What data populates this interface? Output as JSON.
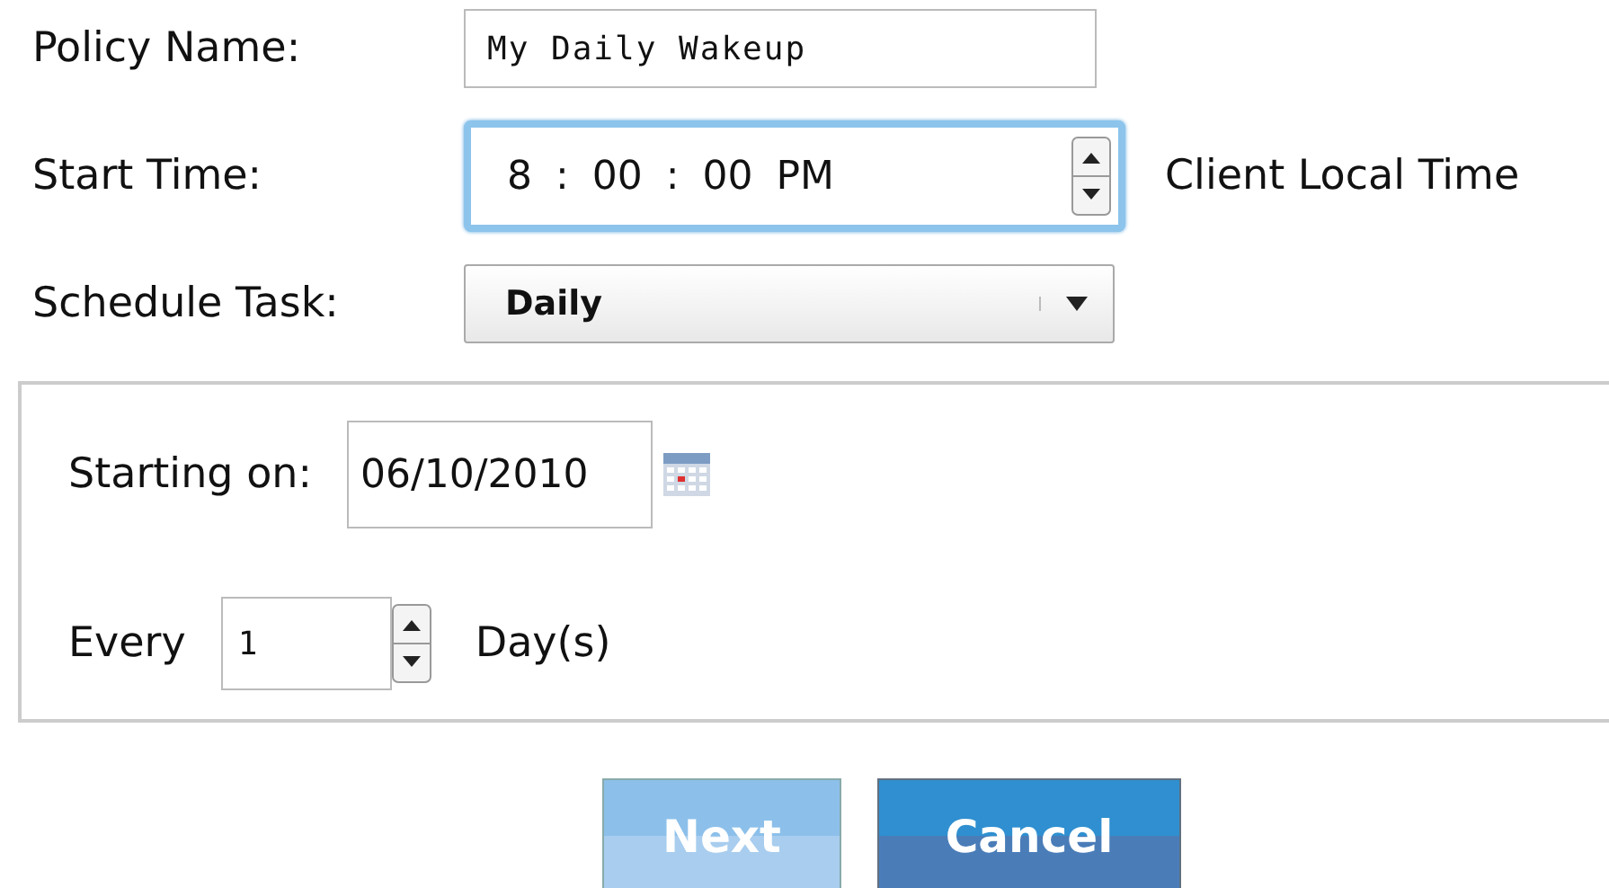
{
  "policy_name": {
    "label": "Policy Name:",
    "value": "My Daily Wakeup"
  },
  "start_time": {
    "label": "Start Time:",
    "value": "8 : 00 : 00 PM",
    "focused": true,
    "note": "Client Local Time"
  },
  "schedule_task": {
    "label": "Schedule Task:",
    "value": "Daily"
  },
  "schedule": {
    "starting_on": {
      "label": "Starting on:",
      "value": "06/10/2010"
    },
    "every": {
      "label": "Every",
      "value": "1",
      "unit": "Day(s)"
    }
  },
  "buttons": [
    {
      "label": "Next",
      "disabled": true
    },
    {
      "label": "Cancel",
      "disabled": false
    }
  ]
}
